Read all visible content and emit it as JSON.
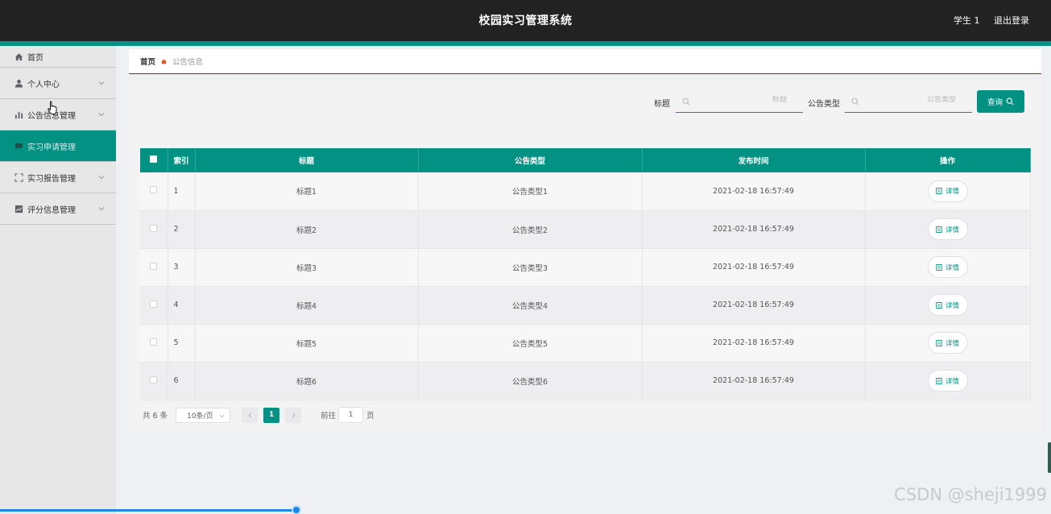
{
  "header": {
    "title": "校园实习管理系统",
    "user": "学生 1",
    "logout": "退出登录"
  },
  "sidebar": {
    "items": [
      {
        "label": "首页",
        "icon": "home-icon"
      },
      {
        "label": "个人中心",
        "icon": "user-icon"
      },
      {
        "label": "公告信息管理",
        "icon": "bar-chart-icon"
      },
      {
        "label": "实习申请管理",
        "icon": "message-icon"
      },
      {
        "label": "实习报告管理",
        "icon": "fullscreen-icon"
      },
      {
        "label": "评分信息管理",
        "icon": "trend-chart-icon"
      }
    ]
  },
  "breadcrumb": {
    "home": "首页",
    "current": "公告信息"
  },
  "search": {
    "title_label": "标题",
    "title_placeholder": "标题",
    "type_label": "公告类型",
    "type_placeholder": "公告类型",
    "button": "查询"
  },
  "table": {
    "columns": [
      "索引",
      "标题",
      "公告类型",
      "发布时间",
      "操作"
    ],
    "rows": [
      {
        "index": "1",
        "title": "标题1",
        "type": "公告类型1",
        "time": "2021-02-18 16:57:49"
      },
      {
        "index": "2",
        "title": "标题2",
        "type": "公告类型2",
        "time": "2021-02-18 16:57:49"
      },
      {
        "index": "3",
        "title": "标题3",
        "type": "公告类型3",
        "time": "2021-02-18 16:57:49"
      },
      {
        "index": "4",
        "title": "标题4",
        "type": "公告类型4",
        "time": "2021-02-18 16:57:49"
      },
      {
        "index": "5",
        "title": "标题5",
        "type": "公告类型5",
        "time": "2021-02-18 16:57:49"
      },
      {
        "index": "6",
        "title": "标题6",
        "type": "公告类型6",
        "time": "2021-02-18 16:57:49"
      }
    ],
    "detail_label": "详情"
  },
  "pagination": {
    "total": "共 6 条",
    "page_size": "10条/页",
    "current_page": "1",
    "goto_prefix": "前往",
    "goto_value": "1",
    "goto_suffix": "页"
  },
  "watermark": "CSDN @sheji1999",
  "colors": {
    "accent": "#039183",
    "header_bg": "#222222"
  }
}
